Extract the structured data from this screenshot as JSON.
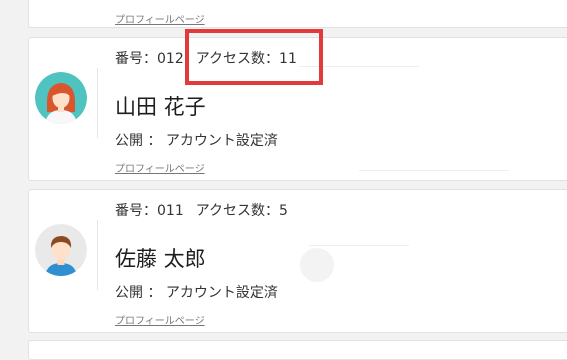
{
  "cards": [
    {
      "profile_link": "プロフィールページ"
    },
    {
      "meta_number": "番号：012",
      "meta_access": "アクセス数：11",
      "name": "山田 花子",
      "status": "公開 ： アカウント設定済",
      "profile_link": "プロフィールページ",
      "avatar_icon": "female-avatar-icon"
    },
    {
      "meta_number": "番号：011",
      "meta_access": "アクセス数：5",
      "name": "佐藤 太郎",
      "status": "公開 ： アカウント設定済",
      "profile_link": "プロフィールページ",
      "avatar_icon": "male-avatar-icon"
    }
  ],
  "colors": {
    "highlight": "#e23a3a",
    "female_bg": "#4fc3c0",
    "female_hair": "#d9552e",
    "male_bg": "#e9e9e9",
    "male_hair": "#8a4a24",
    "shirt": "#2f8fd0"
  }
}
